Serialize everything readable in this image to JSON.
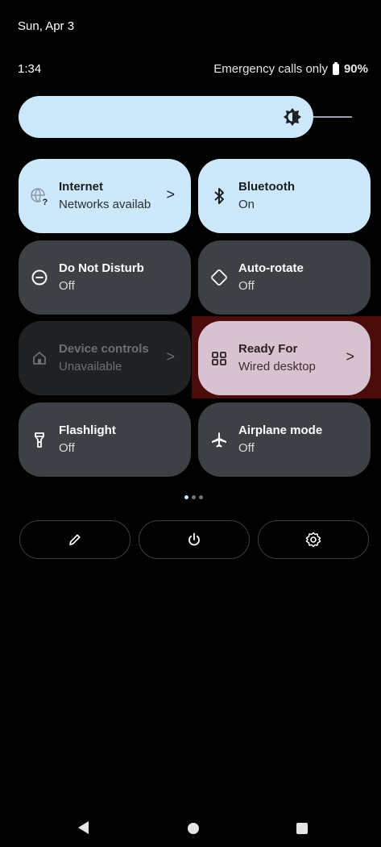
{
  "status": {
    "date": "Sun, Apr 3",
    "time": "1:34",
    "carrier": "Emergency calls only",
    "battery": "90%"
  },
  "brightness": {
    "icon": "brightness-icon",
    "level": 0.86
  },
  "tiles": [
    {
      "title": "Internet",
      "subtitle": "Networks availab",
      "chevron": ">",
      "icon": "internet-unknown-icon",
      "state": "on"
    },
    {
      "title": "Bluetooth",
      "subtitle": "On",
      "icon": "bluetooth-icon",
      "state": "on"
    },
    {
      "title": "Do Not Disturb",
      "subtitle": "Off",
      "icon": "do-not-disturb-icon",
      "state": "off"
    },
    {
      "title": "Auto-rotate",
      "subtitle": "Off",
      "icon": "auto-rotate-icon",
      "state": "off"
    },
    {
      "title": "Device controls",
      "subtitle": "Unavailable",
      "chevron": ">",
      "icon": "home-icon",
      "state": "disabled"
    },
    {
      "title": "Ready For",
      "subtitle": "Wired desktop",
      "chevron": ">",
      "icon": "grid-icon",
      "state": "ready"
    },
    {
      "title": "Flashlight",
      "subtitle": "Off",
      "icon": "flashlight-icon",
      "state": "off"
    },
    {
      "title": "Airplane mode",
      "subtitle": "Off",
      "icon": "airplane-icon",
      "state": "off"
    }
  ],
  "page_indicator": {
    "pages": 3,
    "current": 1
  },
  "actions": [
    {
      "icon": "edit-icon"
    },
    {
      "icon": "power-icon"
    },
    {
      "icon": "settings-icon"
    }
  ],
  "nav": {
    "back": "back-icon",
    "home": "home-nav-icon",
    "recents": "recents-icon"
  }
}
